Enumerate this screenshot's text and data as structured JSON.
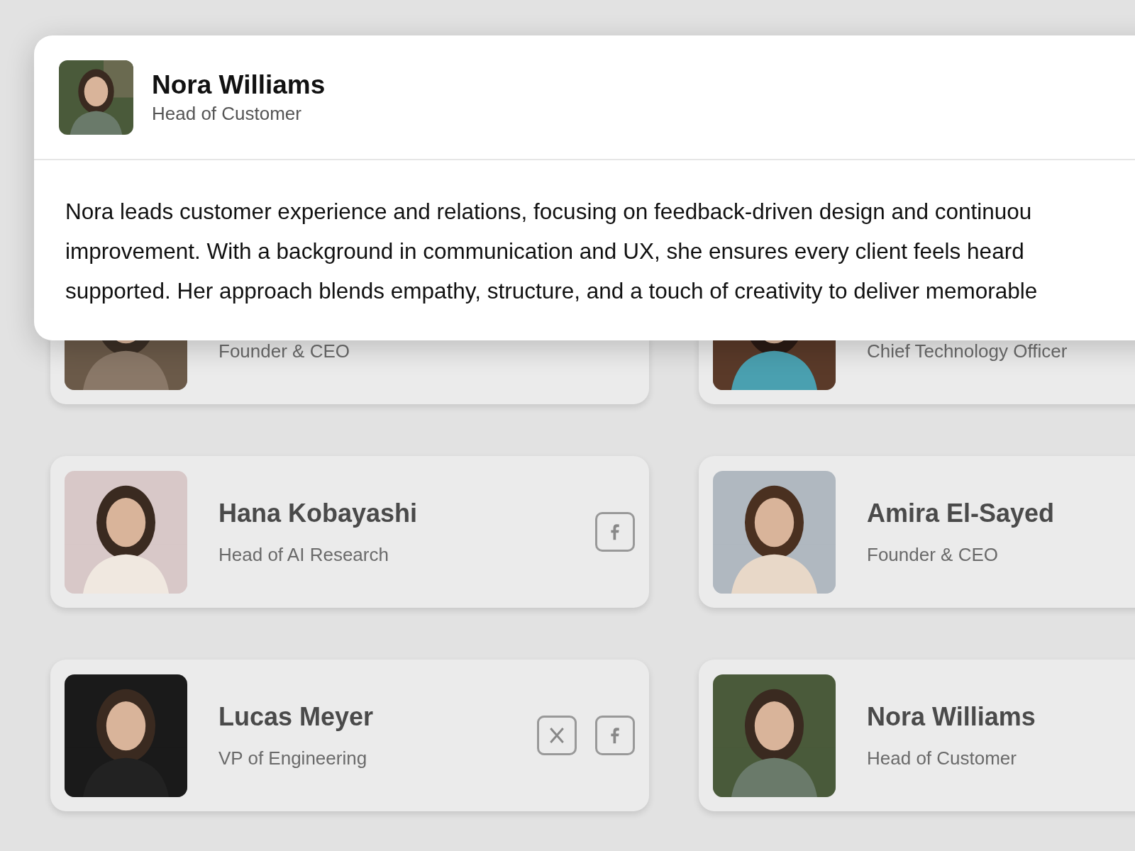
{
  "modal": {
    "name": "Nora Williams",
    "role": "Head of Customer",
    "bio_lines": [
      "Nora leads customer experience and relations, focusing on feedback-driven design and continuou",
      "improvement. With a background in communication and UX, she ensures every client feels heard",
      "supported. Her approach blends empathy, structure, and a touch of creativity to deliver memorable"
    ]
  },
  "team": [
    {
      "role": "Founder & CEO"
    },
    {
      "role": "Chief Technology Officer"
    },
    {
      "name": "Hana Kobayashi",
      "role": "Head of AI Research",
      "social": [
        {
          "kind": "facebook"
        }
      ]
    },
    {
      "name": "Amira El-Sayed",
      "role": "Founder & CEO"
    },
    {
      "name": "Lucas Meyer",
      "role": "VP of Engineering",
      "social": [
        {
          "kind": "x"
        },
        {
          "kind": "facebook"
        }
      ]
    },
    {
      "name": "Nora Williams",
      "role": "Head of Customer"
    }
  ]
}
